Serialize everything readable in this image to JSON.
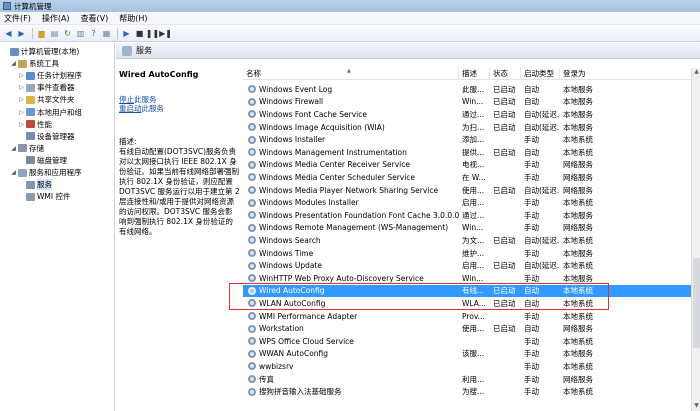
{
  "window": {
    "title": "计算机管理"
  },
  "menu": [
    "文件(F)",
    "操作(A)",
    "查看(V)",
    "帮助(H)"
  ],
  "tree": [
    {
      "label": "计算机管理(本地)",
      "color": "#6b8fbf",
      "indent": 0,
      "exp": ""
    },
    {
      "label": "系统工具",
      "color": "#c6a55a",
      "indent": 1,
      "exp": "◢"
    },
    {
      "label": "任务计划程序",
      "color": "#5b8bd1",
      "indent": 2,
      "exp": "▷"
    },
    {
      "label": "事件查看器",
      "color": "#9aa7b7",
      "indent": 2,
      "exp": "▷"
    },
    {
      "label": "共享文件夹",
      "color": "#d9b44a",
      "indent": 2,
      "exp": "▷"
    },
    {
      "label": "本地用户和组",
      "color": "#6b9bd6",
      "indent": 2,
      "exp": "▷"
    },
    {
      "label": "性能",
      "color": "#c24a3a",
      "indent": 2,
      "exp": "▷"
    },
    {
      "label": "设备管理器",
      "color": "#7d8fa8",
      "indent": 2,
      "exp": ""
    },
    {
      "label": "存储",
      "color": "#8a96a8",
      "indent": 1,
      "exp": "◢"
    },
    {
      "label": "磁盘管理",
      "color": "#7f8b9c",
      "indent": 2,
      "exp": ""
    },
    {
      "label": "服务和应用程序",
      "color": "#8fa4c2",
      "indent": 1,
      "exp": "◢"
    },
    {
      "label": "服务",
      "color": "#7f97b5",
      "indent": 2,
      "exp": "",
      "selected": true
    },
    {
      "label": "WMI 控件",
      "color": "#8c9bb0",
      "indent": 2,
      "exp": ""
    }
  ],
  "header": {
    "title": "服务"
  },
  "detail": {
    "service_name": "Wired AutoConfig",
    "stop_prefix": "停止",
    "stop_suffix": "此服务",
    "restart_prefix": "重启动",
    "restart_suffix": "此服务",
    "desc_label": "描述:",
    "description": "有线自动配置(DOT3SVC)服务负责对以太网接口执行 IEEE 802.1X 身份验证。如果当前有线网络部署强制执行 802.1X 身份验证，则应配置 DOT3SVC 服务运行以用于建立第 2 层连接性和/或用于提供对网络资源的访问权限。DOT3SVC 服务会影响到强制执行 802.1X 身份验证的有线网络。"
  },
  "columns": [
    "名称",
    "描述",
    "状态",
    "启动类型",
    "登录为"
  ],
  "sort_indicator": "▲",
  "services": [
    {
      "name": "Windows Event Log",
      "desc": "此服...",
      "status": "已启动",
      "start": "自动",
      "logon": "本地服务"
    },
    {
      "name": "Windows Firewall",
      "desc": "Win...",
      "status": "已启动",
      "start": "自动",
      "logon": "本地服务"
    },
    {
      "name": "Windows Font Cache Service",
      "desc": "通过...",
      "status": "已启动",
      "start": "自动(延迟...",
      "logon": "本地服务"
    },
    {
      "name": "Windows Image Acquisition (WIA)",
      "desc": "为扫...",
      "status": "已启动",
      "start": "自动(延迟...",
      "logon": "本地服务"
    },
    {
      "name": "Windows Installer",
      "desc": "添加...",
      "status": "",
      "start": "手动",
      "logon": "本地系统"
    },
    {
      "name": "Windows Management Instrumentation",
      "desc": "提供...",
      "status": "已启动",
      "start": "自动",
      "logon": "本地系统"
    },
    {
      "name": "Windows Media Center Receiver Service",
      "desc": "电视...",
      "status": "",
      "start": "手动",
      "logon": "网络服务"
    },
    {
      "name": "Windows Media Center Scheduler Service",
      "desc": "在 W...",
      "status": "",
      "start": "手动",
      "logon": "网络服务"
    },
    {
      "name": "Windows Media Player Network Sharing Service",
      "desc": "使用...",
      "status": "已启动",
      "start": "自动(延迟...",
      "logon": "网络服务"
    },
    {
      "name": "Windows Modules Installer",
      "desc": "启用...",
      "status": "",
      "start": "手动",
      "logon": "本地系统"
    },
    {
      "name": "Windows Presentation Foundation Font Cache 3.0.0.0",
      "desc": "通过...",
      "status": "",
      "start": "手动",
      "logon": "本地服务"
    },
    {
      "name": "Windows Remote Management (WS-Management)",
      "desc": "Win...",
      "status": "",
      "start": "手动",
      "logon": "网络服务"
    },
    {
      "name": "Windows Search",
      "desc": "为文...",
      "status": "已启动",
      "start": "自动(延迟...",
      "logon": "本地系统"
    },
    {
      "name": "Windows Time",
      "desc": "维护...",
      "status": "",
      "start": "手动",
      "logon": "本地服务"
    },
    {
      "name": "Windows Update",
      "desc": "启用...",
      "status": "已启动",
      "start": "自动(延迟...",
      "logon": "本地系统"
    },
    {
      "name": "WinHTTP Web Proxy Auto-Discovery Service",
      "desc": "Win...",
      "status": "",
      "start": "手动",
      "logon": "本地服务"
    },
    {
      "name": "Wired AutoConfig",
      "desc": "有线...",
      "status": "已启动",
      "start": "自动",
      "logon": "本地系统",
      "selected": true
    },
    {
      "name": "WLAN AutoConfig",
      "desc": "WLA...",
      "status": "已启动",
      "start": "自动",
      "logon": "本地系统"
    },
    {
      "name": "WMI Performance Adapter",
      "desc": "Prov...",
      "status": "",
      "start": "手动",
      "logon": "本地系统"
    },
    {
      "name": "Workstation",
      "desc": "使用...",
      "status": "已启动",
      "start": "自动",
      "logon": "网络服务"
    },
    {
      "name": "WPS Office Cloud Service",
      "desc": "",
      "status": "",
      "start": "手动",
      "logon": "本地系统"
    },
    {
      "name": "WWAN AutoConfig",
      "desc": "该服...",
      "status": "",
      "start": "手动",
      "logon": "本地服务"
    },
    {
      "name": "wwbizsrv",
      "desc": "",
      "status": "",
      "start": "手动",
      "logon": "本地系统"
    },
    {
      "name": "传真",
      "desc": "利用...",
      "status": "",
      "start": "手动",
      "logon": "网络服务"
    },
    {
      "name": "搜狗拼音输入法基础服务",
      "desc": "为搜...",
      "status": "",
      "start": "手动",
      "logon": "本地系统"
    }
  ]
}
